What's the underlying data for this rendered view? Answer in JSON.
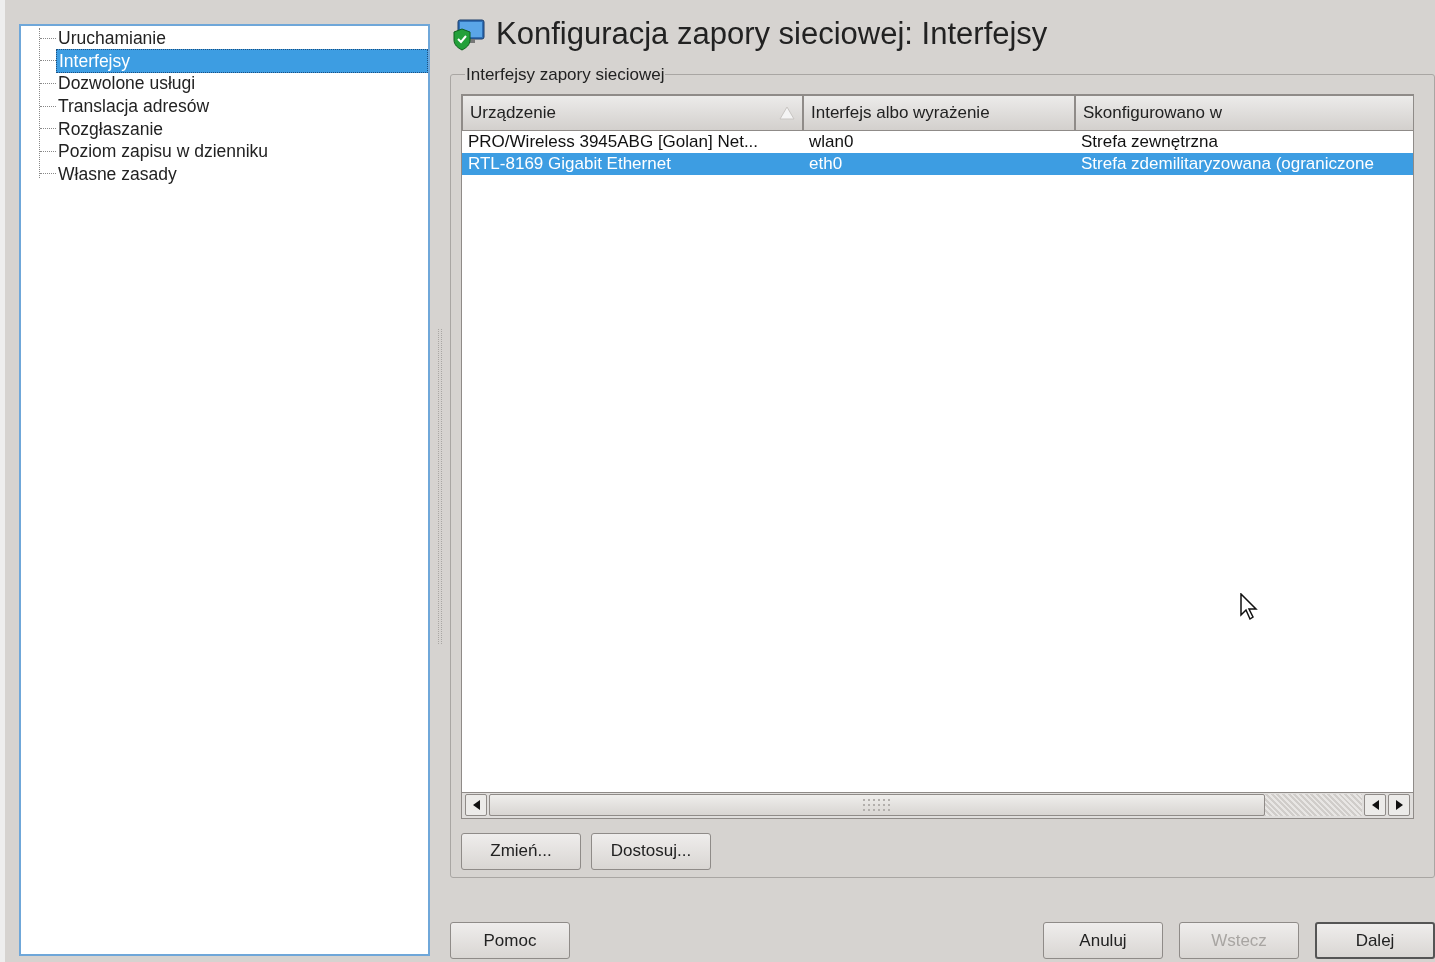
{
  "sidebar": {
    "items": [
      {
        "label": "Uruchamianie",
        "selected": false
      },
      {
        "label": "Interfejsy",
        "selected": true
      },
      {
        "label": "Dozwolone usługi",
        "selected": false
      },
      {
        "label": "Translacja adresów",
        "selected": false
      },
      {
        "label": "Rozgłaszanie",
        "selected": false
      },
      {
        "label": "Poziom zapisu w dzienniku",
        "selected": false
      },
      {
        "label": "Własne zasady",
        "selected": false
      }
    ]
  },
  "title": "Konfiguracja zapory sieciowej: Interfejsy",
  "group": {
    "title": "Interfejsy zapory sieciowej",
    "table": {
      "columns": [
        {
          "label": "Urządzenie",
          "sorted": true
        },
        {
          "label": "Interfejs albo wyrażenie",
          "sorted": false
        },
        {
          "label": "Skonfigurowano w",
          "sorted": false
        }
      ],
      "rows": [
        {
          "cells": [
            "PRO/Wireless 3945ABG [Golan] Net...",
            "wlan0",
            "Strefa zewnętrzna"
          ],
          "selected": false
        },
        {
          "cells": [
            "RTL-8169 Gigabit Ethernet",
            "eth0",
            "Strefa zdemilitaryzowana (ograniczone"
          ],
          "selected": true
        }
      ]
    },
    "buttons": [
      "Zmień...",
      "Dostosuj..."
    ]
  },
  "footer": {
    "left_buttons": [
      {
        "label": "Pomoc",
        "disabled": false,
        "default": false
      }
    ],
    "right_buttons": [
      {
        "label": "Anuluj",
        "disabled": false,
        "default": false
      },
      {
        "label": "Wstecz",
        "disabled": true,
        "default": false
      },
      {
        "label": "Dalej",
        "disabled": false,
        "default": true
      }
    ]
  }
}
